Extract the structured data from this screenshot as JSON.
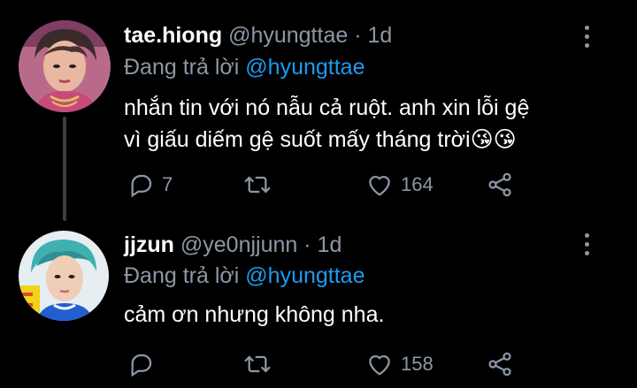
{
  "tweets": [
    {
      "display_name": "tae.hiong",
      "handle": "@hyungttae",
      "separator": "·",
      "time": "1d",
      "reply_prefix": "Đang trả lời",
      "reply_to": "@hyungttae",
      "text_line1": "nhắn tin với nó nẫu cả ruột. anh xin lỗi gệ",
      "text_line2": "vì giấu diếm gệ suốt mấy tháng trời",
      "emojis": "😘😘",
      "reply_count": "7",
      "retweet_count": "",
      "like_count": "164"
    },
    {
      "display_name": "jjzun",
      "handle": "@ye0njjunn",
      "separator": "·",
      "time": "1d",
      "reply_prefix": "Đang trả lời",
      "reply_to": "@hyungttae",
      "text_line1": "cảm ơn nhưng không nha.",
      "reply_count": "",
      "retweet_count": "",
      "like_count": "158"
    }
  ],
  "colors": {
    "background": "#000000",
    "text": "#ffffff",
    "muted": "#8b98a5",
    "link": "#1d9bf0",
    "thread_line": "#3a3f44"
  },
  "icons": [
    "reply-icon",
    "retweet-icon",
    "like-icon",
    "share-icon",
    "more-options-icon"
  ]
}
